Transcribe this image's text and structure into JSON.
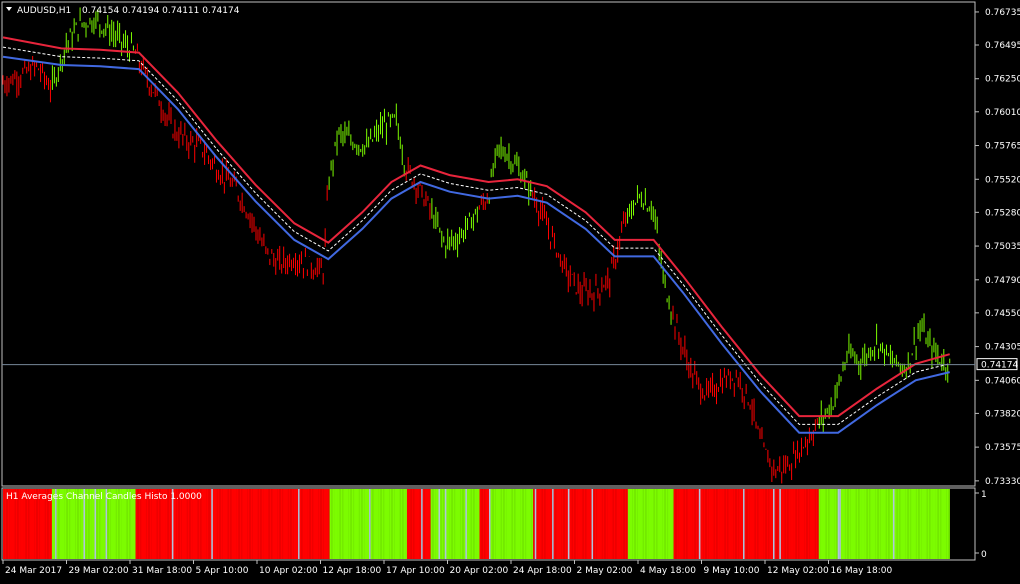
{
  "main": {
    "symbol_label": "AUDUSD,H1",
    "ohlc_label": "0.74154 0.74194 0.74111 0.74174",
    "current_price_label": "0.74174",
    "current_price": 0.74174
  },
  "indicator": {
    "label": "H1 Averages Channel Candles Histo 1.0000",
    "scale_top": "1",
    "scale_bottom": "0"
  },
  "colors": {
    "background": "#000000",
    "frame": "#c0c0c0",
    "bull": "#7cfc00",
    "bear": "#ff0000",
    "neutral": "#b0c4de",
    "upper_band": "#e8253c",
    "lower_band": "#4169e1",
    "mid_line": "#ffffff",
    "price_line": "#778899"
  },
  "chart_data": {
    "type": "line",
    "ylim": [
      0.733,
      0.768
    ],
    "y_ticks": [
      "0.76735",
      "0.76495",
      "0.76250",
      "0.76010",
      "0.75765",
      "0.75520",
      "0.75280",
      "0.75035",
      "0.74790",
      "0.74550",
      "0.74305",
      "0.74060",
      "0.73820",
      "0.73575",
      "0.73330"
    ],
    "x_ticks": [
      "24 Mar 2017",
      "29 Mar 02:00",
      "31 Mar 18:00",
      "5 Apr 10:00",
      "10 Apr 02:00",
      "12 Apr 18:00",
      "17 Apr 10:00",
      "20 Apr 02:00",
      "24 Apr 18:00",
      "2 May 02:00",
      "4 May 18:00",
      "9 May 10:00",
      "12 May 02:00",
      "16 May 18:00"
    ],
    "price_path": [
      [
        0,
        0.7622
      ],
      [
        0.02,
        0.7628
      ],
      [
        0.035,
        0.7634
      ],
      [
        0.05,
        0.7618
      ],
      [
        0.065,
        0.765
      ],
      [
        0.08,
        0.7665
      ],
      [
        0.095,
        0.7668
      ],
      [
        0.11,
        0.766
      ],
      [
        0.125,
        0.765
      ],
      [
        0.135,
        0.7645
      ],
      [
        0.145,
        0.763
      ],
      [
        0.16,
        0.761
      ],
      [
        0.175,
        0.7588
      ],
      [
        0.19,
        0.758
      ],
      [
        0.205,
        0.7575
      ],
      [
        0.22,
        0.756
      ],
      [
        0.24,
        0.7545
      ],
      [
        0.255,
        0.7525
      ],
      [
        0.27,
        0.75
      ],
      [
        0.285,
        0.749
      ],
      [
        0.3,
        0.7495
      ],
      [
        0.315,
        0.749
      ],
      [
        0.33,
        0.7485
      ],
      [
        0.335,
        0.7548
      ],
      [
        0.345,
        0.7585
      ],
      [
        0.36,
        0.758
      ],
      [
        0.375,
        0.7575
      ],
      [
        0.39,
        0.759
      ],
      [
        0.405,
        0.7595
      ],
      [
        0.415,
        0.756
      ],
      [
        0.425,
        0.755
      ],
      [
        0.44,
        0.753
      ],
      [
        0.455,
        0.7505
      ],
      [
        0.47,
        0.751
      ],
      [
        0.485,
        0.7525
      ],
      [
        0.5,
        0.754
      ],
      [
        0.51,
        0.7575
      ],
      [
        0.52,
        0.757
      ],
      [
        0.535,
        0.7555
      ],
      [
        0.55,
        0.7535
      ],
      [
        0.565,
        0.751
      ],
      [
        0.58,
        0.7485
      ],
      [
        0.595,
        0.747
      ],
      [
        0.61,
        0.747
      ],
      [
        0.625,
        0.748
      ],
      [
        0.64,
        0.752
      ],
      [
        0.655,
        0.754
      ],
      [
        0.67,
        0.753
      ],
      [
        0.68,
        0.748
      ],
      [
        0.695,
        0.744
      ],
      [
        0.71,
        0.741
      ],
      [
        0.725,
        0.7395
      ],
      [
        0.74,
        0.7405
      ],
      [
        0.755,
        0.741
      ],
      [
        0.77,
        0.739
      ],
      [
        0.78,
        0.736
      ],
      [
        0.795,
        0.734
      ],
      [
        0.81,
        0.7345
      ],
      [
        0.825,
        0.736
      ],
      [
        0.84,
        0.7375
      ],
      [
        0.855,
        0.739
      ],
      [
        0.87,
        0.7425
      ],
      [
        0.885,
        0.742
      ],
      [
        0.9,
        0.7435
      ],
      [
        0.915,
        0.742
      ],
      [
        0.93,
        0.7415
      ],
      [
        0.945,
        0.7445
      ],
      [
        0.955,
        0.743
      ],
      [
        0.97,
        0.7418
      ]
    ],
    "series": [
      {
        "values": [
          [
            0,
            0.7655
          ],
          [
            0.06,
            0.7647
          ],
          [
            0.1,
            0.7646
          ],
          [
            0.14,
            0.7644
          ],
          [
            0.18,
            0.7615
          ],
          [
            0.22,
            0.758
          ],
          [
            0.26,
            0.7548
          ],
          [
            0.3,
            0.752
          ],
          [
            0.335,
            0.7506
          ],
          [
            0.37,
            0.7528
          ],
          [
            0.4,
            0.755
          ],
          [
            0.43,
            0.7562
          ],
          [
            0.46,
            0.7555
          ],
          [
            0.5,
            0.755
          ],
          [
            0.53,
            0.7552
          ],
          [
            0.56,
            0.7547
          ],
          [
            0.6,
            0.7528
          ],
          [
            0.63,
            0.7508
          ],
          [
            0.67,
            0.7508
          ],
          [
            0.7,
            0.7482
          ],
          [
            0.74,
            0.7445
          ],
          [
            0.78,
            0.741
          ],
          [
            0.82,
            0.738
          ],
          [
            0.86,
            0.738
          ],
          [
            0.9,
            0.74
          ],
          [
            0.94,
            0.7418
          ],
          [
            0.975,
            0.7425
          ]
        ]
      },
      {
        "values": [
          [
            0,
            0.7648
          ],
          [
            0.06,
            0.7641
          ],
          [
            0.1,
            0.764
          ],
          [
            0.14,
            0.7638
          ],
          [
            0.18,
            0.7609
          ],
          [
            0.22,
            0.7574
          ],
          [
            0.26,
            0.7542
          ],
          [
            0.3,
            0.7514
          ],
          [
            0.335,
            0.75
          ],
          [
            0.37,
            0.7522
          ],
          [
            0.4,
            0.7544
          ],
          [
            0.43,
            0.7556
          ],
          [
            0.46,
            0.7549
          ],
          [
            0.5,
            0.7544
          ],
          [
            0.53,
            0.7546
          ],
          [
            0.56,
            0.7541
          ],
          [
            0.6,
            0.7522
          ],
          [
            0.63,
            0.7502
          ],
          [
            0.67,
            0.7502
          ],
          [
            0.7,
            0.7476
          ],
          [
            0.74,
            0.7439
          ],
          [
            0.78,
            0.7404
          ],
          [
            0.82,
            0.7374
          ],
          [
            0.86,
            0.7374
          ],
          [
            0.9,
            0.7394
          ],
          [
            0.94,
            0.7412
          ],
          [
            0.975,
            0.7418
          ]
        ]
      },
      {
        "values": [
          [
            0,
            0.7641
          ],
          [
            0.06,
            0.7635
          ],
          [
            0.1,
            0.7634
          ],
          [
            0.14,
            0.7632
          ],
          [
            0.18,
            0.7603
          ],
          [
            0.22,
            0.7568
          ],
          [
            0.26,
            0.7536
          ],
          [
            0.3,
            0.7508
          ],
          [
            0.335,
            0.7494
          ],
          [
            0.37,
            0.7516
          ],
          [
            0.4,
            0.7538
          ],
          [
            0.43,
            0.755
          ],
          [
            0.46,
            0.7543
          ],
          [
            0.5,
            0.7538
          ],
          [
            0.53,
            0.754
          ],
          [
            0.56,
            0.7535
          ],
          [
            0.6,
            0.7516
          ],
          [
            0.63,
            0.7496
          ],
          [
            0.67,
            0.7496
          ],
          [
            0.7,
            0.747
          ],
          [
            0.74,
            0.7433
          ],
          [
            0.78,
            0.7398
          ],
          [
            0.82,
            0.7368
          ],
          [
            0.86,
            0.7368
          ],
          [
            0.9,
            0.7388
          ],
          [
            0.94,
            0.7406
          ],
          [
            0.975,
            0.7412
          ]
        ]
      }
    ],
    "histogram_segments": [
      {
        "from": 0.0,
        "to": 0.05,
        "state": "bear"
      },
      {
        "from": 0.05,
        "to": 0.135,
        "state": "bull"
      },
      {
        "from": 0.135,
        "to": 0.335,
        "state": "bear"
      },
      {
        "from": 0.335,
        "to": 0.415,
        "state": "bull"
      },
      {
        "from": 0.415,
        "to": 0.44,
        "state": "bear"
      },
      {
        "from": 0.44,
        "to": 0.49,
        "state": "bull"
      },
      {
        "from": 0.49,
        "to": 0.5,
        "state": "bear"
      },
      {
        "from": 0.5,
        "to": 0.545,
        "state": "bull"
      },
      {
        "from": 0.545,
        "to": 0.643,
        "state": "bear"
      },
      {
        "from": 0.643,
        "to": 0.69,
        "state": "bull"
      },
      {
        "from": 0.69,
        "to": 0.84,
        "state": "bear"
      },
      {
        "from": 0.84,
        "to": 0.975,
        "state": "bull"
      }
    ]
  }
}
